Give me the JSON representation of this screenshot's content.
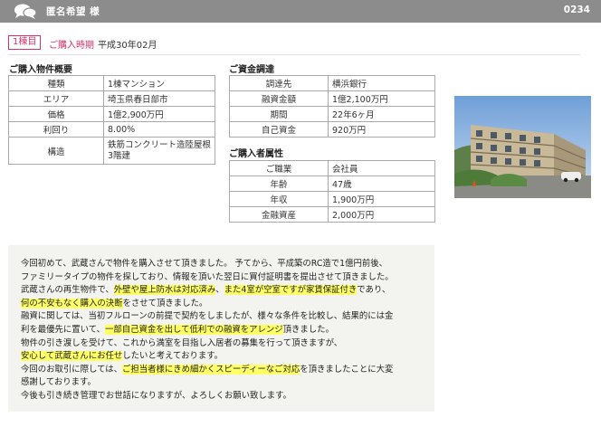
{
  "header": {
    "title": "匿名希望 様",
    "code": "0234",
    "icon": "chat-bubbles-icon"
  },
  "purchase": {
    "badge": "1棟目",
    "date_label": "ご購入時期",
    "date_value": "平成30年02月"
  },
  "property": {
    "title": "ご購入物件概要",
    "rows": [
      {
        "label": "種類",
        "value": "1棟マンション"
      },
      {
        "label": "エリア",
        "value": "埼玉県春日部市"
      },
      {
        "label": "価格",
        "value": "1億2,900万円"
      },
      {
        "label": "利回り",
        "value": "8.00%"
      },
      {
        "label": "構造",
        "value": "鉄筋コンクリート造陸屋根3階建"
      }
    ]
  },
  "funding": {
    "title": "ご資金調達",
    "rows": [
      {
        "label": "調達先",
        "value": "横浜銀行"
      },
      {
        "label": "融資金額",
        "value": "1億2,100万円"
      },
      {
        "label": "期間",
        "value": "22年6ヶ月"
      },
      {
        "label": "自己資金",
        "value": "920万円"
      }
    ]
  },
  "buyer": {
    "title": "ご購入者属性",
    "rows": [
      {
        "label": "ご職業",
        "value": "会社員"
      },
      {
        "label": "年齢",
        "value": "47歳"
      },
      {
        "label": "年収",
        "value": "1,900万円"
      },
      {
        "label": "金融資産",
        "value": "2,000万円"
      }
    ]
  },
  "comment": {
    "lines": [
      [
        {
          "text": "今回初めて、武蔵さんで物件を購入させて頂きました。 予てから、平成築のRC造で1億円前後、",
          "hl": false
        }
      ],
      [
        {
          "text": "ファミリータイプの物件を探しており、情報を頂いた翌日に買付証明書を提出させて頂きました。",
          "hl": false
        }
      ],
      [
        {
          "text": "武蔵さんの再生物件で、",
          "hl": false
        },
        {
          "text": "外壁や屋上防水は対応済み",
          "hl": true
        },
        {
          "text": "、",
          "hl": false
        },
        {
          "text": "また4室が空室ですが家賃保証付き",
          "hl": true
        },
        {
          "text": "であり、",
          "hl": false
        }
      ],
      [
        {
          "text": "何の不安もなく購入の決断",
          "hl": true
        },
        {
          "text": "をさせて頂きました。",
          "hl": false
        }
      ],
      [
        {
          "text": "融資に関しては、当初フルローンの前提で契約をしましたが、様々な条件を比較し、結果的には金",
          "hl": false
        }
      ],
      [
        {
          "text": "利を最優先に置いて、",
          "hl": false
        },
        {
          "text": "一部自己資金を出して低利での融資をアレンジ",
          "hl": true
        },
        {
          "text": "頂きました。",
          "hl": false
        }
      ],
      [
        {
          "text": "物件の引き渡しを受けて、これから満室を目指し入居者の募集を行って頂きますが、",
          "hl": false
        }
      ],
      [
        {
          "text": "安心して武蔵さんにお任せ",
          "hl": true
        },
        {
          "text": "したいと考えております。",
          "hl": false
        }
      ],
      [
        {
          "text": "今回のお取引に際しては、",
          "hl": false
        },
        {
          "text": "ご担当者様にきめ細かくスピーディーなご対応",
          "hl": true
        },
        {
          "text": "を頂きましたことに大変",
          "hl": false
        }
      ],
      [
        {
          "text": "感謝しております。",
          "hl": false
        }
      ],
      [
        {
          "text": "今後も引き続き管理でお世話になりますが、よろしくお願い致します。",
          "hl": false
        }
      ]
    ]
  }
}
